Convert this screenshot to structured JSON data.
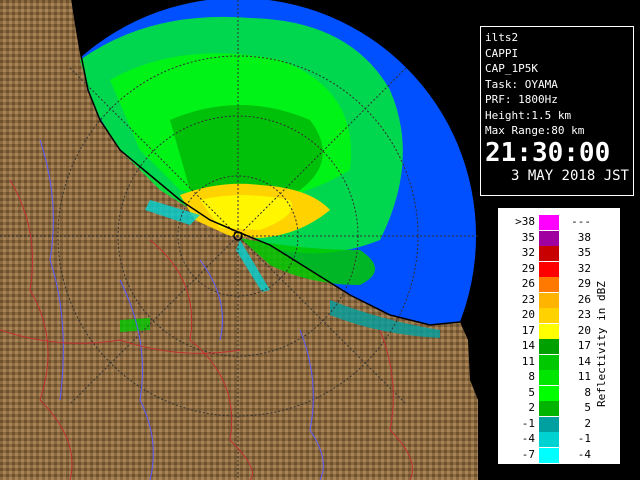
{
  "info": {
    "site": "ilts2",
    "product": "CAPPI",
    "product_code": "CAP_1P5K",
    "task": "Task: OYAMA",
    "prf": "PRF: 1800Hz",
    "height": "Height:1.5 km",
    "max_range": "Max Range:80 km",
    "time": "21:30:00",
    "date": "3 MAY 2018 JST"
  },
  "legend": {
    "unit_label": "Reflectivity in dBZ",
    "rows": [
      {
        "lo": ">38",
        "hi": "---",
        "color": "#ff00ff"
      },
      {
        "lo": "35",
        "hi": "38",
        "color": "#a000a0"
      },
      {
        "lo": "32",
        "hi": "35",
        "color": "#c80000"
      },
      {
        "lo": "29",
        "hi": "32",
        "color": "#ff0000"
      },
      {
        "lo": "26",
        "hi": "29",
        "color": "#ff7800"
      },
      {
        "lo": "23",
        "hi": "26",
        "color": "#ffb400"
      },
      {
        "lo": "20",
        "hi": "23",
        "color": "#ffd200"
      },
      {
        "lo": "17",
        "hi": "20",
        "color": "#ffff00"
      },
      {
        "lo": "14",
        "hi": "17",
        "color": "#00a000"
      },
      {
        "lo": "11",
        "hi": "14",
        "color": "#00c800"
      },
      {
        "lo": "8",
        "hi": "11",
        "color": "#00e600"
      },
      {
        "lo": "5",
        "hi": "8",
        "color": "#00ff00"
      },
      {
        "lo": "2",
        "hi": "5",
        "color": "#00b400"
      },
      {
        "lo": "-1",
        "hi": "2",
        "color": "#00a0a0"
      },
      {
        "lo": "-4",
        "hi": "-1",
        "color": "#00d2d2"
      },
      {
        "lo": "-7",
        "hi": "-4",
        "color": "#00ffff"
      }
    ]
  },
  "map_colors": {
    "ocean": "#0050ff",
    "land": "#8c6a40",
    "range_ring": "#404040",
    "rivers": "#5a5aff",
    "borders": "#c03030"
  }
}
